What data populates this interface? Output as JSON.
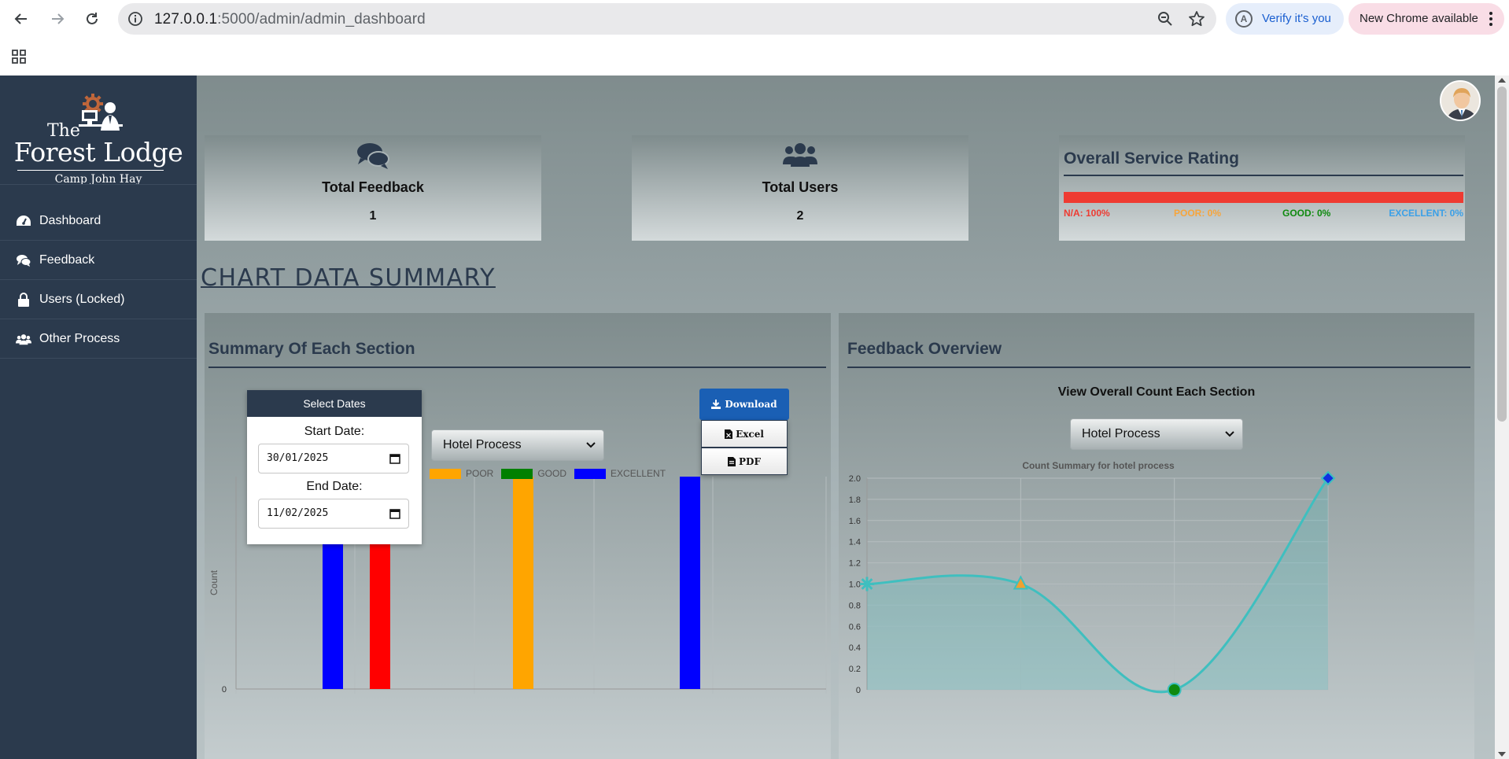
{
  "browser": {
    "url_host": "127.0.0.1",
    "url_path": ":5000/admin/admin_dashboard",
    "verify_label": "Verify it's you",
    "update_label": "New Chrome available",
    "profile_letter": "A"
  },
  "sidebar": {
    "logo_the": "The",
    "logo_name": "Forest Lodge",
    "logo_sub": "Camp John Hay",
    "items": [
      {
        "label": "Dashboard",
        "icon": "dashboard-icon"
      },
      {
        "label": "Feedback",
        "icon": "comments-icon"
      },
      {
        "label": "Users (Locked)",
        "icon": "lock-icon"
      },
      {
        "label": "Other Process",
        "icon": "users-icon"
      }
    ]
  },
  "stats": {
    "feedback_title": "Total Feedback",
    "feedback_value": "1",
    "users_title": "Total Users",
    "users_value": "2"
  },
  "rating": {
    "title": "Overall Service Rating",
    "na_fraction": 1.0,
    "na": "N/A: 100%",
    "poor": "POOR: 0%",
    "good": "GOOD: 0%",
    "excellent": "EXCELLENT: 0%",
    "colors": {
      "na": "#ee3b32",
      "poor": "#f7a53b",
      "good": "#0f8a0f",
      "excellent": "#3aa0e8"
    }
  },
  "section_heading": "CHART DATA SUMMARY",
  "summary_panel": {
    "title": "Summary Of Each Section",
    "select_dates_label": "Select Dates",
    "start_label": "Start Date:",
    "start_value": "30/01/2025",
    "end_label": "End Date:",
    "end_value": "11/02/2025",
    "process_select": "Hotel Process",
    "download_label": "Download",
    "excel_label": "Excel",
    "pdf_label": "PDF"
  },
  "feedback_panel": {
    "title": "Feedback Overview",
    "subtitle": "View Overall Count Each Section",
    "process_select": "Hotel Process"
  },
  "chart_data": [
    {
      "type": "bar",
      "ylabel": "Count",
      "y_tick_visible": "0",
      "legend": [
        {
          "name": "POOR",
          "color": "#ffa500"
        },
        {
          "name": "GOOD",
          "color": "#008000"
        },
        {
          "name": "EXCELLENT",
          "color": "#0000ff"
        }
      ],
      "bars": [
        {
          "color": "#0000ff",
          "value": 1
        },
        {
          "color": "#ff0000",
          "value": 1
        },
        {
          "color": "#ffa500",
          "value": 1
        },
        {
          "color": "#0000ff",
          "value": 1
        }
      ],
      "ylim": [
        0,
        1
      ]
    },
    {
      "type": "area",
      "title": "Count Summary for hotel process",
      "y_ticks": [
        "2.0",
        "1.8",
        "1.6",
        "1.4",
        "1.2",
        "1.0",
        "0.8",
        "0.6",
        "0.4",
        "0.2",
        "0"
      ],
      "ylim": [
        0,
        2
      ],
      "values": [
        1,
        1,
        0,
        2
      ],
      "line_color": "#3fbfbf",
      "point_colors": [
        "#3fbfbf",
        "#f0a030",
        "#0f8a0f",
        "#1030e0"
      ],
      "point_shapes": [
        "star",
        "triangle",
        "circle",
        "diamond"
      ]
    }
  ]
}
